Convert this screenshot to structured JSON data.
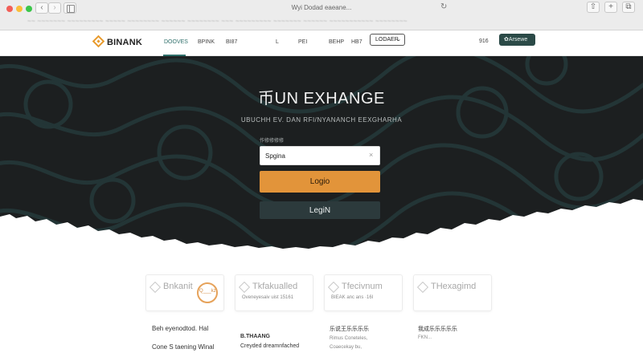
{
  "browser": {
    "page_title": "Wyi Dodad eaeane...",
    "url_text": "~~ ~~~~~~~ ~~~~~~~~~ ~~~~~ ~~~~~~~~ ~~~~~~ ~~~~~~~~ ~~~ ~~~~~~~~~ ~~~~~~~ ~~~~~~ ~~~~~~~~~~~ ~~~~~~~~",
    "back_glyph": "‹",
    "forward_glyph": "›",
    "reload_glyph": "↻",
    "share_glyph": "⇧",
    "newtab_glyph": "+",
    "tabs_glyph": "⧉"
  },
  "nav": {
    "logo_text": "BINANK",
    "links": {
      "devices": "DOOVES",
      "bpink": "BPINK",
      "b87": "BI87",
      "l": "L",
      "pei": "PEI",
      "behp": "BEHP",
      "hb7": "HB7"
    },
    "loader_label": "LODAER",
    "loader_chevron": "⌄",
    "num_text": "916",
    "account_label": "✿Arsewe"
  },
  "hero": {
    "title": "币UN EXHANGE",
    "subtitle": "UBUCHH EV. DAN RFI/NYANANCH EEXGHARHA",
    "field_label": "作修修修修",
    "search_value": "Spgina",
    "clear_glyph": "×",
    "login_primary_label": "Logio",
    "login_secondary_label": "LegiN"
  },
  "partners": {
    "card1": {
      "title": "Bnkanit",
      "badge": "Q___kz"
    },
    "card2": {
      "title": "Tkfakualled",
      "sub": "Oveneyesaiv uist  15161"
    },
    "card3": {
      "title": "Tfecivnum",
      "sub": "BIEAK anc ans   ·16l"
    },
    "card4": {
      "title": "THexagimd"
    }
  },
  "info": {
    "col1": [
      "Beh eyenodtod.   Hal",
      "Cone S taening Winal"
    ],
    "col2": [
      "B.THAANG",
      "Creyded dreamnfached"
    ],
    "col3": [
      "乐说王乐乐乐乐",
      "Rimus Coneteles,",
      "Coaecekay bu,"
    ],
    "col4": [
      "我成乐乐乐乐乐",
      "FKN..."
    ]
  },
  "colors": {
    "accent_orange": "#e2943a",
    "accent_teal": "#2b4a47",
    "hero_background": "#1c1f20"
  }
}
